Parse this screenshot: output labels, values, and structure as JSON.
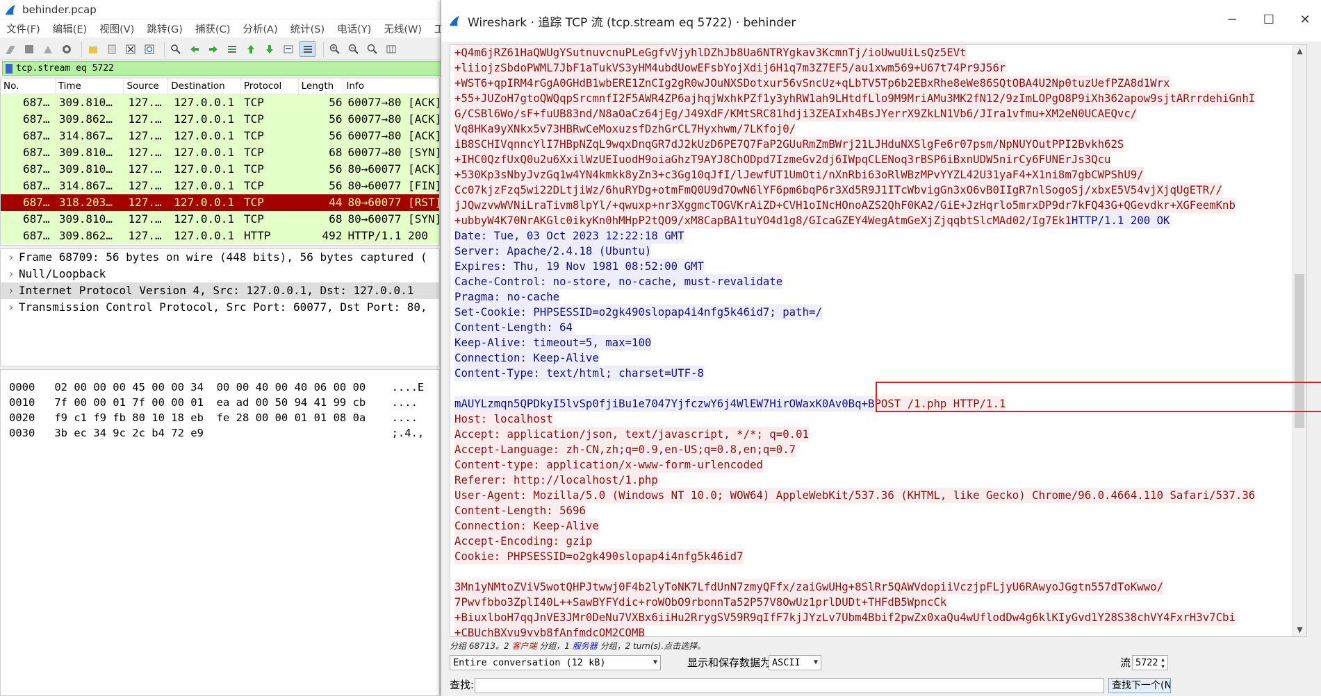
{
  "main_window": {
    "title": "behinder.pcap",
    "menu": [
      "文件(F)",
      "编辑(E)",
      "视图(V)",
      "跳转(G)",
      "捕获(C)",
      "分析(A)",
      "统计(S)",
      "电话(Y)",
      "无线(W)",
      "工具"
    ],
    "filter": "tcp.stream eq 5722",
    "columns": [
      "No.",
      "Time",
      "Source",
      "Destination",
      "Protocol",
      "Length",
      "Info"
    ],
    "packets": [
      {
        "no": "687…",
        "time": "309.810…",
        "src": "127.…",
        "dst": "127.0.0.1",
        "proto": "TCP",
        "len": "56",
        "info": "60077→80 [ACK]"
      },
      {
        "no": "687…",
        "time": "309.862…",
        "src": "127.…",
        "dst": "127.0.0.1",
        "proto": "TCP",
        "len": "56",
        "info": "60077→80 [ACK]"
      },
      {
        "no": "687…",
        "time": "314.867…",
        "src": "127.…",
        "dst": "127.0.0.1",
        "proto": "TCP",
        "len": "56",
        "info": "60077→80 [ACK]"
      },
      {
        "no": "687…",
        "time": "309.810…",
        "src": "127.…",
        "dst": "127.0.0.1",
        "proto": "TCP",
        "len": "68",
        "info": "60077→80 [SYN]"
      },
      {
        "no": "687…",
        "time": "309.810…",
        "src": "127.…",
        "dst": "127.0.0.1",
        "proto": "TCP",
        "len": "56",
        "info": "80→60077 [ACK]"
      },
      {
        "no": "687…",
        "time": "314.867…",
        "src": "127.…",
        "dst": "127.0.0.1",
        "proto": "TCP",
        "len": "56",
        "info": "80→60077 [FIN]"
      },
      {
        "no": "687…",
        "time": "318.203…",
        "src": "127.…",
        "dst": "127.0.0.1",
        "proto": "TCP",
        "len": "44",
        "info": "80→60077 [RST]"
      },
      {
        "no": "687…",
        "time": "309.810…",
        "src": "127.…",
        "dst": "127.0.0.1",
        "proto": "TCP",
        "len": "68",
        "info": "80→60077 [SYN]"
      },
      {
        "no": "687…",
        "time": "309.862…",
        "src": "127.…",
        "dst": "127.0.0.1",
        "proto": "HTTP",
        "len": "492",
        "info": "HTTP/1.1 200 "
      }
    ],
    "details": [
      "Frame 68709: 56 bytes on wire (448 bits), 56 bytes captured (",
      "Null/Loopback",
      "Internet Protocol Version 4, Src: 127.0.0.1, Dst: 127.0.0.1",
      "Transmission Control Protocol, Src Port: 60077, Dst Port: 80,"
    ],
    "bytes": [
      "0000   02 00 00 00 45 00 00 34  00 00 40 00 40 06 00 00    ....E",
      "0010   7f 00 00 01 7f 00 00 01  ea ad 00 50 94 41 99 cb    ....",
      "0020   f9 c1 f9 fb 80 10 18 eb  fe 28 00 00 01 01 08 0a    ....",
      "0030   3b ec 34 9c 2c b4 72 e9                             ;.4.,"
    ]
  },
  "dialog": {
    "title": "Wireshark · 追踪 TCP 流 (tcp.stream eq 5722) · behinder",
    "stream": [
      {
        "parts": [
          {
            "t": "+Q4m6jRZ61HaQWUgYSutnuvcnuPLeGgfvVjyhlDZhJb8Ua6NTRYgkav3KcmnTj/ioUwuUiLsQz5EVt",
            "c": "cl"
          }
        ]
      },
      {
        "parts": [
          {
            "t": "+liiojzSbdoPWML7JbF1aTukVS3yHM4ubdUowEFsbYojXdij6H1q7m3Z7EF5/au1xwm569+U67t74Pr9J56r",
            "c": "cl"
          }
        ]
      },
      {
        "parts": [
          {
            "t": "+WST6+qpIRM4rGgA0GHdB1wbERE1ZnCIg2gR0wJOuNXSDotxur56vSncUz+qLbTV5Tp6b2EBxRhe8eWe86SQtOBA4U2Np0tuzUefPZA8d1Wrx",
            "c": "cl"
          }
        ]
      },
      {
        "parts": [
          {
            "t": "+55+JUZoH7gtoQWQqpSrcmnfI2F5AWR4ZP6ajhqjWxhkPZf1y3yhRW1ah9LHtdfLlo9M9MriAMu3MK2fN12/9zImLOPgO8P9iXh362apow9sjtARrrdehiGnhI",
            "c": "cl"
          }
        ]
      },
      {
        "parts": [
          {
            "t": "G/CSBl6Wo/sF+fuUB83nd/N8aOaCz64jEg/J49XdF/KMtSRC81hdji3ZEAIxh4BsJYerrX9ZkLN1Vb6/JIra1vfmu+XM2eN0UCAEQvc/",
            "c": "cl"
          }
        ]
      },
      {
        "parts": [
          {
            "t": "Vq8HKa9yXNkx5v73HBRwCeMoxuzsfDzhGrCL7Hyxhwm/7LKfoj0/",
            "c": "cl"
          }
        ]
      },
      {
        "parts": [
          {
            "t": "iB8SCHIVqnncYlI7HBpNZqL9wqxDnqGR7dJ2kUzD6PE7Q7FaP2GUuRmZmBWrj21LJHduNXSlgFe6r07psm/NpNUYOutPPI2Bvkh62S",
            "c": "cl"
          }
        ]
      },
      {
        "parts": [
          {
            "t": "+IHC0QzfUxQ0u2u6XxilWzUEIuodH9oiaGhzT9AYJ8ChODpd7IzmeGv2dj6IWpqCLENoq3rBSP6iBxnUDW5nirCy6FUNErJs3Qcu",
            "c": "cl"
          }
        ]
      },
      {
        "parts": [
          {
            "t": "+530Kp3sNbyJvzGq1w4YN4kmkk8yZn3+c3Gg10qJfI/lJewfUT1UmOti/nXnRbi63oRlWBzMPvYYZL42U31yaF4+X1ni8m7gbCWPShU9/",
            "c": "cl"
          }
        ]
      },
      {
        "parts": [
          {
            "t": "Cc07kjzFzq5wi22DLtjiWz/6huRYDg+otmFmQ0U9d7OwN6lYF6pm6bqP6r3Xd5R9J1ITcWbvigGn3xO6vB0IIgR7nlSogoSj/xbxE5V54vjXjqUgETR//",
            "c": "cl"
          }
        ]
      },
      {
        "parts": [
          {
            "t": "jJQwzvwWVNiLraTivm8lpYl/+qwuxp+nr3XggmcTOGVKrAiZD+CVH1oINcHOnoAZS2QhF0KA2/GiE+JzHqrlo5mrxDP9dr7kFQ43G+QGevdkr+XGFeemKnb",
            "c": "cl"
          }
        ]
      },
      {
        "parts": [
          {
            "t": "+ubbyW4K70NrAKGlc0ikyKn0hMHpP2tQO9/xM8CapBA1tuYO4d1g8/GIcaGZEY4WegAtmGeXjZjqqbtSlcMAd02/Ig7Ek1",
            "c": "cl"
          },
          {
            "t": "HTTP/1.1 200 OK",
            "c": "sv"
          }
        ]
      },
      {
        "parts": [
          {
            "t": "Date: Tue, 03 Oct 2023 12:22:18 GMT",
            "c": "sv"
          }
        ]
      },
      {
        "parts": [
          {
            "t": "Server: Apache/2.4.18 (Ubuntu)",
            "c": "sv"
          }
        ]
      },
      {
        "parts": [
          {
            "t": "Expires: Thu, 19 Nov 1981 08:52:00 GMT",
            "c": "sv"
          }
        ]
      },
      {
        "parts": [
          {
            "t": "Cache-Control: no-store, no-cache, must-revalidate",
            "c": "sv"
          }
        ]
      },
      {
        "parts": [
          {
            "t": "Pragma: no-cache",
            "c": "sv"
          }
        ]
      },
      {
        "parts": [
          {
            "t": "Set-Cookie: PHPSESSID=o2gk490slopap4i4nfg5k46id7; path=/",
            "c": "sv"
          }
        ]
      },
      {
        "parts": [
          {
            "t": "Content-Length: 64",
            "c": "sv"
          }
        ]
      },
      {
        "parts": [
          {
            "t": "Keep-Alive: timeout=5, max=100",
            "c": "sv"
          }
        ]
      },
      {
        "parts": [
          {
            "t": "Connection: Keep-Alive",
            "c": "sv"
          }
        ]
      },
      {
        "parts": [
          {
            "t": "Content-Type: text/html; charset=UTF-8",
            "c": "sv"
          }
        ]
      },
      {
        "parts": []
      },
      {
        "parts": [
          {
            "t": "mAUYLzmqn5QPDkyI5lvSp0fjiBu1e7047YjfczwY6j4WlEW7HirOWaxK0Av0Bq+B",
            "c": "sv"
          },
          {
            "t": "POST /1.php HTTP/1.1",
            "c": "cl"
          }
        ]
      },
      {
        "parts": [
          {
            "t": "Host: localhost",
            "c": "cl"
          }
        ]
      },
      {
        "parts": [
          {
            "t": "Accept: application/json, text/javascript, */*; q=0.01",
            "c": "cl"
          }
        ]
      },
      {
        "parts": [
          {
            "t": "Accept-Language: zh-CN,zh;q=0.9,en-US;q=0.8,en;q=0.7",
            "c": "cl"
          }
        ]
      },
      {
        "parts": [
          {
            "t": "Content-type: application/x-www-form-urlencoded",
            "c": "cl"
          }
        ]
      },
      {
        "parts": [
          {
            "t": "Referer: http://localhost/1.php",
            "c": "cl"
          }
        ]
      },
      {
        "parts": [
          {
            "t": "User-Agent: Mozilla/5.0 (Windows NT 10.0; WOW64) AppleWebKit/537.36 (KHTML, like Gecko) Chrome/96.0.4664.110 Safari/537.36",
            "c": "cl"
          }
        ]
      },
      {
        "parts": [
          {
            "t": "Content-Length: 5696",
            "c": "cl"
          }
        ]
      },
      {
        "parts": [
          {
            "t": "Connection: Keep-Alive",
            "c": "cl"
          }
        ]
      },
      {
        "parts": [
          {
            "t": "Accept-Encoding: gzip",
            "c": "cl"
          }
        ]
      },
      {
        "parts": [
          {
            "t": "Cookie: PHPSESSID=o2gk490slopap4i4nfg5k46id7",
            "c": "cl"
          }
        ]
      },
      {
        "parts": []
      },
      {
        "parts": [
          {
            "t": "3Mn1yNMtoZViV5wotQHPJtwwj0F4b2lyToNK7LfdUnN7zmyQFfx/zaiGwUHg+8SlRr5QAWVdopiiVczjpFLjyU6RAwyoJGgtn557dToKwwo/",
            "c": "cl"
          }
        ]
      },
      {
        "parts": [
          {
            "t": "7Pwvfbbo3ZplI40L++SawBYFYdic+roWObO9rbonnTa52P57V8OwUz1prlDUDt+THFdB5WpncCk",
            "c": "cl"
          }
        ]
      },
      {
        "parts": [
          {
            "t": "+BiuxlboH7qqJnVE3JMr0DeNu7VXBx6iiHu2RrygSV59R9qIfF7kjJYzLv7Ubm4Bbif2pwZx0xaQu4wUflodDw4g6klKIyGvd1Y28S38chVY4FxrH3v7Cbi",
            "c": "cl"
          }
        ]
      },
      {
        "parts": [
          {
            "t": "+CBUchBXvu9yyb8fAnfmdcOM2COMB",
            "c": "cl"
          }
        ]
      }
    ],
    "status": {
      "prefix": "分组 68713。2 ",
      "client_label": "客户端",
      "mid": " 分组，1 ",
      "server_label": "服务器",
      "suffix": " 分组，2 turn(s).点击选择。"
    },
    "conversation_select": "Entire conversation (12 kB)",
    "show_save_label": "显示和保存数据为",
    "format_select": "ASCII",
    "stream_label": "流",
    "stream_number": "5722",
    "find_label": "查找:",
    "find_value": "",
    "find_next_button": "查找下一个(N)"
  },
  "colors": {
    "client_text": "#8b1010",
    "client_bg": "#fbeded",
    "server_text": "#10108b",
    "server_bg": "#ededfb",
    "filter_bg": "#b5f0a3",
    "tcp_row_bg": "#e4ffc7",
    "rst_row_bg": "#a40000",
    "highlight": "#e02020"
  }
}
